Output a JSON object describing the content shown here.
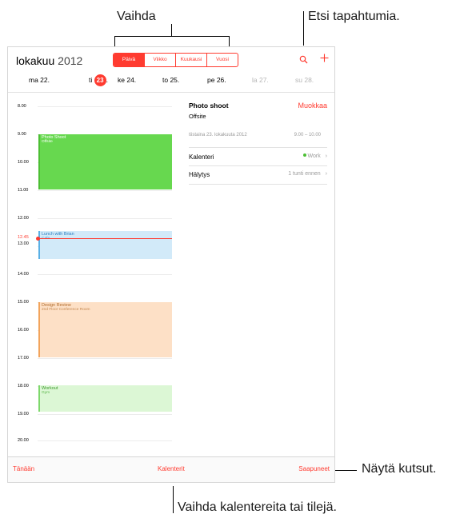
{
  "annotations": {
    "vaihda": "Vaihda",
    "etsi": "Etsi tapahtumia.",
    "nayta": "Näytä kutsut.",
    "vaihda_kalenterit": "Vaihda kalentereita tai tilejä."
  },
  "header": {
    "month": "lokakuu",
    "year": "2012",
    "segments": [
      "Päivä",
      "Viikko",
      "Kuukausi",
      "Vuosi"
    ],
    "search_icon": "search-icon",
    "add_icon": "plus-icon"
  },
  "week": [
    {
      "label": "ma 22.",
      "state": "normal"
    },
    {
      "prefix": "ti",
      "num": "23",
      "suffix": ".",
      "state": "today"
    },
    {
      "label": "ke 24.",
      "state": "normal"
    },
    {
      "label": "to 25.",
      "state": "normal"
    },
    {
      "label": "pe 26.",
      "state": "normal"
    },
    {
      "label": "la 27.",
      "state": "dim"
    },
    {
      "label": "su 28.",
      "state": "dim"
    }
  ],
  "times": [
    "8.00",
    "9.00",
    "10.00",
    "11.00",
    "12.00",
    "13.00",
    "14.00",
    "15.00",
    "16.00",
    "17.00",
    "18.00",
    "19.00",
    "20.00"
  ],
  "now_time": "12.45",
  "events": [
    {
      "title": "Photo Shoot",
      "subtitle": "Offsite",
      "bg": "#67d84f",
      "border": "#4cbf34",
      "text_color": "#ffffff"
    },
    {
      "title": "Lunch with Brian",
      "subtitle": "Cafe",
      "bg": "#d2eaf9",
      "border": "#5ab0e6",
      "text_color": "#2a7ec0"
    },
    {
      "title": "Design Review",
      "subtitle": "2nd Floor Conference Room",
      "bg": "#fde0c6",
      "border": "#f2a45c",
      "text_color": "#b06a2a"
    },
    {
      "title": "Workout",
      "subtitle": "Gym",
      "bg": "#dcf7d5",
      "border": "#7ed86b",
      "text_color": "#3d9a2c"
    }
  ],
  "detail": {
    "title": "Photo shoot",
    "edit": "Muokkaa",
    "location": "Offsite",
    "date": "tiistaina 23. lokakuuta 2012",
    "time_range": "9.00 – 10.00",
    "calendar_label": "Kalenteri",
    "calendar_value": "Work",
    "calendar_dot_color": "#4cbf34",
    "alert_label": "Hälytys",
    "alert_value": "1 tunti ennen"
  },
  "bottom": {
    "today": "Tänään",
    "calendars": "Kalenterit",
    "inbox": "Saapuneet"
  },
  "accent": "#ff3b30"
}
